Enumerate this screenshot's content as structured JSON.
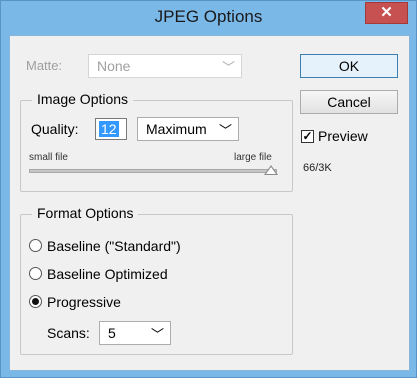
{
  "window": {
    "title": "JPEG Options",
    "close_glyph": "✕"
  },
  "matte": {
    "label": "Matte:",
    "value": "None",
    "icon": "chevron-down-icon"
  },
  "buttons": {
    "ok": "OK",
    "cancel": "Cancel"
  },
  "image_options": {
    "legend": "Image Options",
    "quality_label": "Quality:",
    "quality_value": "12",
    "quality_preset": "Maximum",
    "small_label": "small file",
    "large_label": "large file",
    "slider_fraction": 1.0
  },
  "format_options": {
    "legend": "Format Options",
    "options": [
      {
        "label": "Baseline (\"Standard\")",
        "checked": false
      },
      {
        "label": "Baseline Optimized",
        "checked": false
      },
      {
        "label": "Progressive",
        "checked": true
      }
    ],
    "scans_label": "Scans:",
    "scans_value": "5"
  },
  "preview": {
    "label": "Preview",
    "checked": true,
    "check_glyph": "✓",
    "size_readout": "66/3K"
  },
  "colors": {
    "frame": "#7ab8e8",
    "close": "#c75050",
    "selection": "#3399ff"
  }
}
